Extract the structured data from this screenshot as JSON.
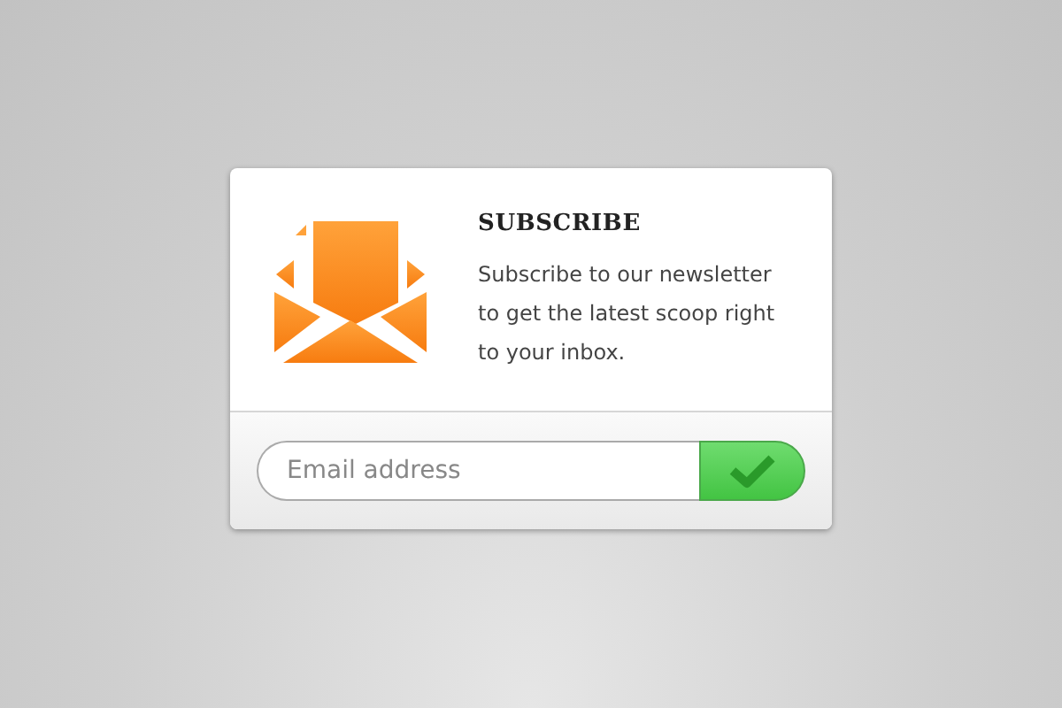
{
  "card": {
    "title": "SUBSCRIBE",
    "description": "Subscribe to our newsletter to get the latest scoop right to your inbox."
  },
  "form": {
    "placeholder": "Email address"
  }
}
